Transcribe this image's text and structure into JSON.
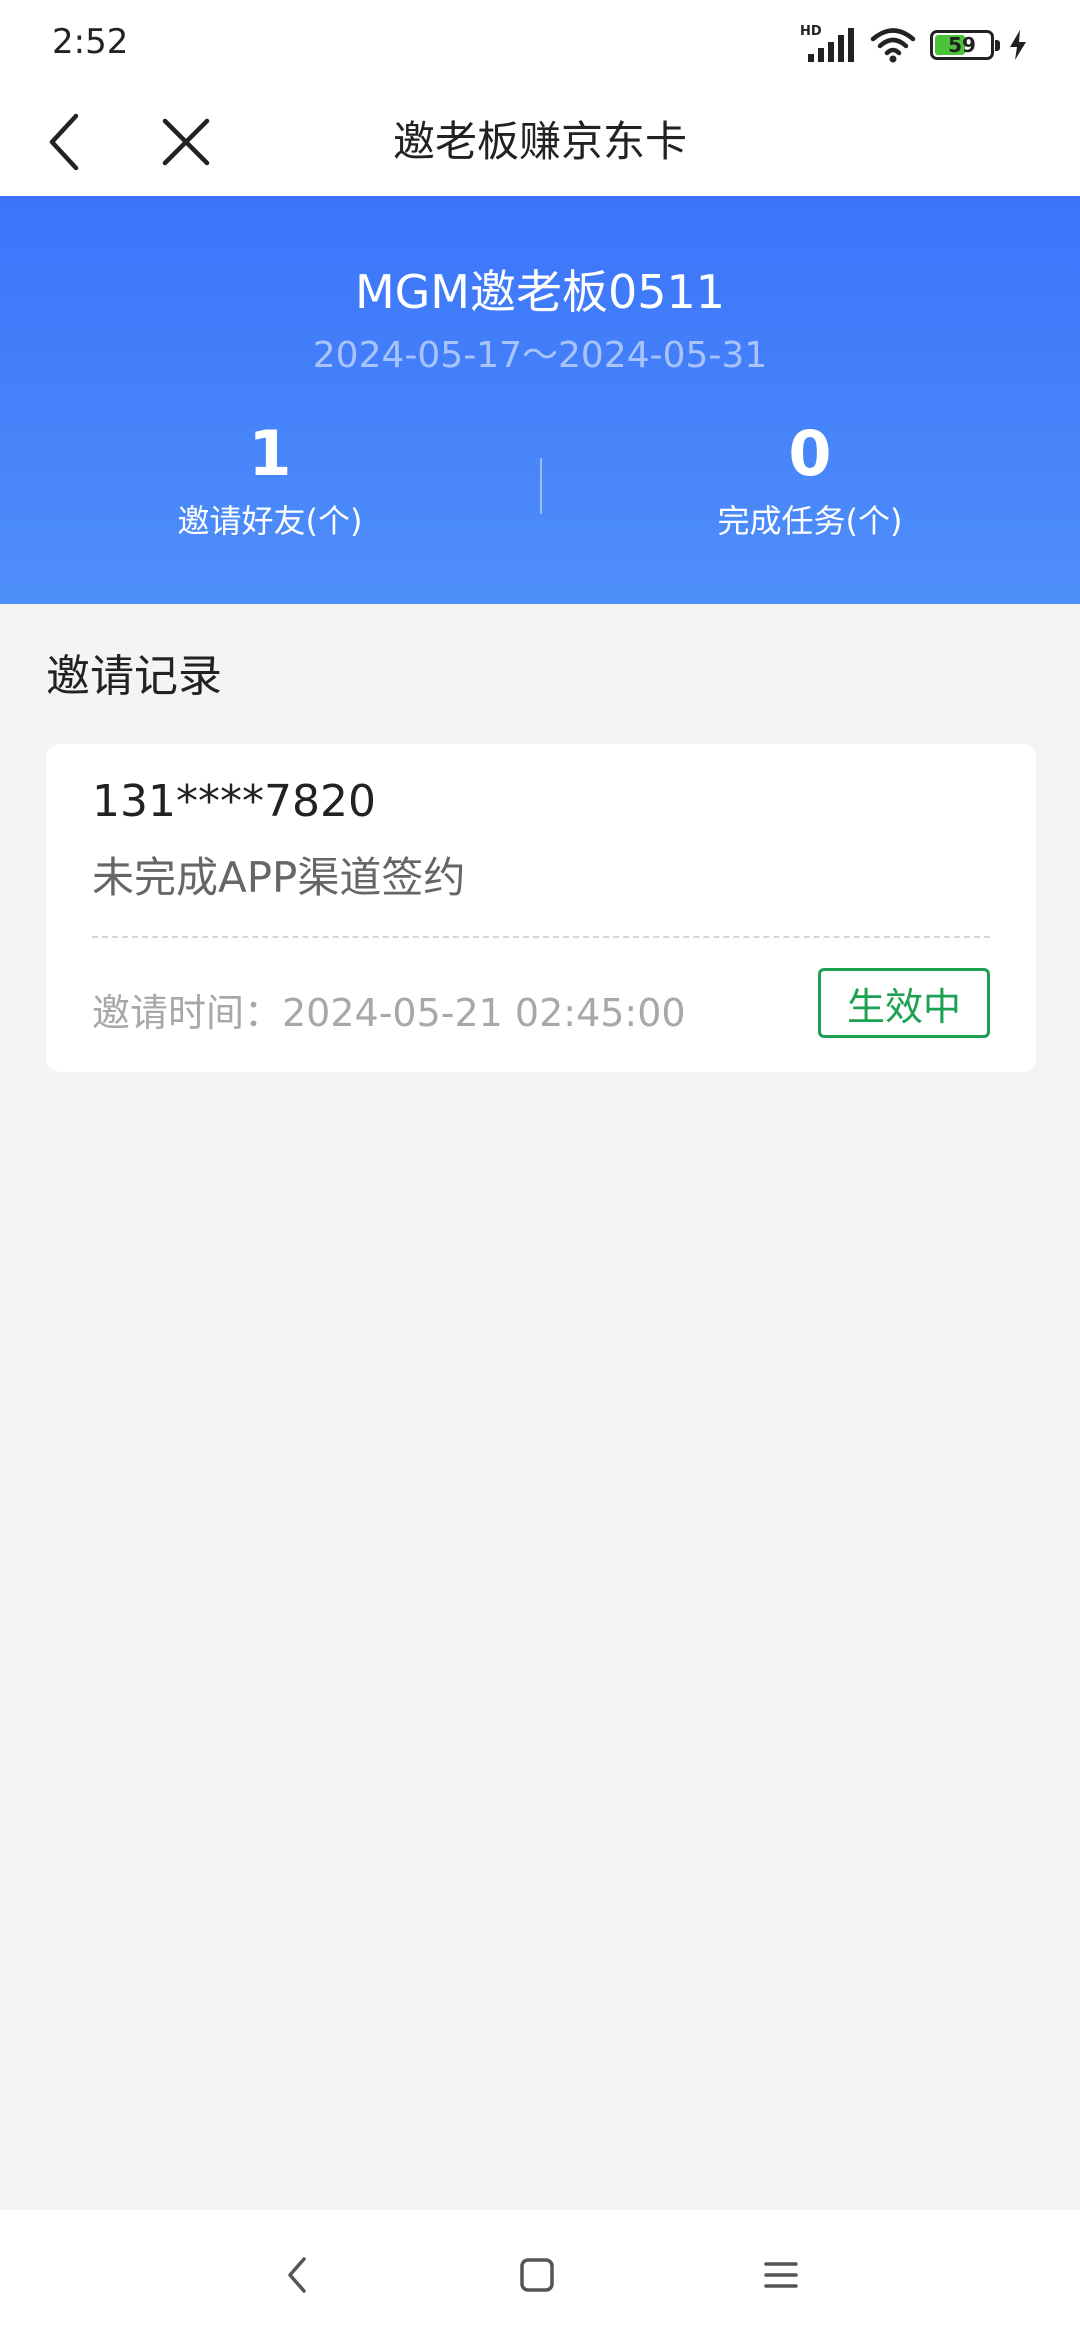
{
  "status_bar": {
    "time": "2:52",
    "network_label": "HD",
    "battery_level": "59",
    "battery_fraction": 0.59,
    "battery_color": "#4cc23a"
  },
  "nav": {
    "title": "邀老板赚京东卡"
  },
  "banner": {
    "title": "MGM邀老板0511",
    "dates": "2024-05-17～2024-05-31",
    "gradient_top": "#3b74fb",
    "gradient_bottom": "#4f8ff9",
    "stats": [
      {
        "value": "1",
        "label": "邀请好友(个)"
      },
      {
        "value": "0",
        "label": "完成任务(个)"
      }
    ]
  },
  "section": {
    "title": "邀请记录"
  },
  "records": [
    {
      "phone": "131****7820",
      "status_text": "未完成APP渠道签约",
      "time_label": "邀请时间：2024-05-21 02:45:00",
      "badge": "生效中",
      "badge_color": "#1ba14f"
    }
  ],
  "icons": {
    "back": "chevron-left-icon",
    "close": "close-icon",
    "signal": "signal-icon",
    "wifi": "wifi-icon",
    "battery": "battery-icon",
    "charging": "lightning-icon",
    "sys_back": "back-triangle-icon",
    "sys_home": "home-square-icon",
    "sys_menu": "menu-lines-icon"
  }
}
